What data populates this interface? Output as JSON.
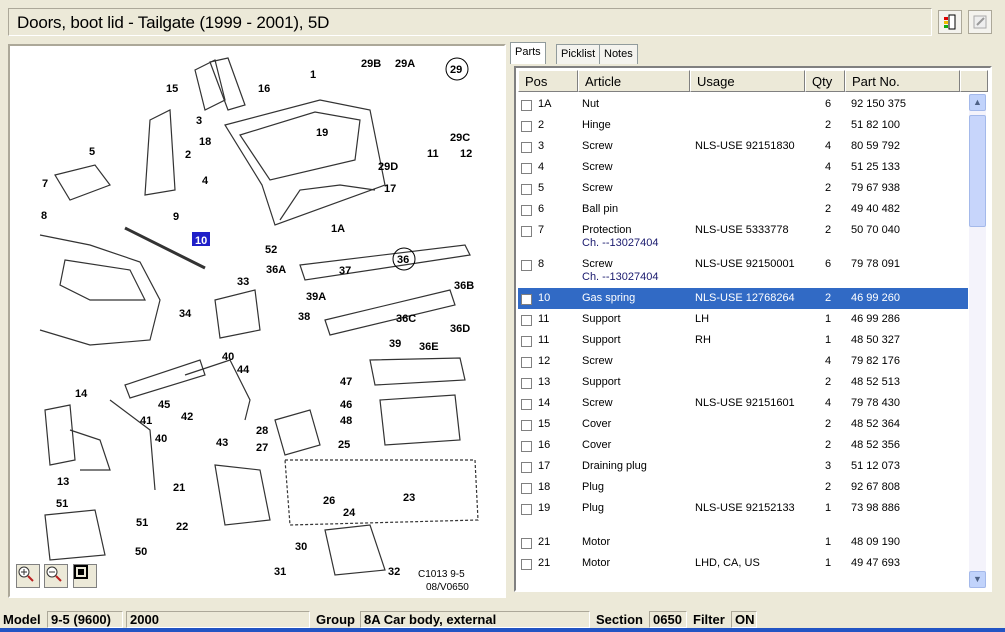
{
  "title": "Doors, boot lid - Tailgate   (1999 - 2001), 5D",
  "toolbar": {
    "icons": [
      "exit-icon",
      "note-icon"
    ]
  },
  "tabs": [
    {
      "label": "Parts",
      "active": true
    },
    {
      "label": "Picklist"
    },
    {
      "label": "Notes"
    }
  ],
  "columns": [
    "Pos",
    "Article",
    "Usage",
    "Qty",
    "Part No."
  ],
  "rows": [
    {
      "pos": "1A",
      "article": "Nut",
      "usage": "",
      "qty": "6",
      "part": "92 150 375"
    },
    {
      "pos": "2",
      "article": "Hinge",
      "usage": "",
      "qty": "2",
      "part": "51 82 100"
    },
    {
      "pos": "3",
      "article": "Screw",
      "usage": "NLS-USE 92151830",
      "qty": "4",
      "part": "80 59 792"
    },
    {
      "pos": "4",
      "article": "Screw",
      "usage": "",
      "qty": "4",
      "part": "51 25 133"
    },
    {
      "pos": "5",
      "article": "Screw",
      "usage": "",
      "qty": "2",
      "part": "79 67 938"
    },
    {
      "pos": "6",
      "article": "Ball pin",
      "usage": "",
      "qty": "2",
      "part": "49 40 482"
    },
    {
      "pos": "7",
      "article": "Protection",
      "usage": "NLS-USE 5333778",
      "qty": "2",
      "part": "50 70 040",
      "note": "Ch. --13027404"
    },
    {
      "pos": "8",
      "article": "Screw",
      "usage": "NLS-USE 92150001",
      "qty": "6",
      "part": "79 78 091",
      "note": "Ch. --13027404"
    },
    {
      "pos": "10",
      "article": "Gas spring",
      "usage": "NLS-USE 12768264",
      "qty": "2",
      "part": "46 99 260",
      "selected": true
    },
    {
      "pos": "11",
      "article": "Support",
      "usage": "LH",
      "qty": "1",
      "part": "46 99 286"
    },
    {
      "pos": "11",
      "article": "Support",
      "usage": "RH",
      "qty": "1",
      "part": "48 50 327"
    },
    {
      "pos": "12",
      "article": "Screw",
      "usage": "",
      "qty": "4",
      "part": "79 82 176"
    },
    {
      "pos": "13",
      "article": "Support",
      "usage": "",
      "qty": "2",
      "part": "48 52 513"
    },
    {
      "pos": "14",
      "article": "Screw",
      "usage": "NLS-USE 92151601",
      "qty": "4",
      "part": "79 78 430"
    },
    {
      "pos": "15",
      "article": "Cover",
      "usage": "",
      "qty": "2",
      "part": "48 52 364"
    },
    {
      "pos": "16",
      "article": "Cover",
      "usage": "",
      "qty": "2",
      "part": "48 52 356"
    },
    {
      "pos": "17",
      "article": "Draining plug",
      "usage": "",
      "qty": "3",
      "part": "51 12 073"
    },
    {
      "pos": "18",
      "article": "Plug",
      "usage": "",
      "qty": "2",
      "part": "92 67 808"
    },
    {
      "pos": "19",
      "article": "Plug",
      "usage": "NLS-USE 92152133",
      "qty": "1",
      "part": "73 98 886",
      "note": ""
    },
    {
      "pos": "21",
      "article": "Motor",
      "usage": "",
      "qty": "1",
      "part": "48 09 190"
    },
    {
      "pos": "21",
      "article": "Motor",
      "usage": "LHD, CA, US",
      "qty": "1",
      "part": "49 47 693"
    }
  ],
  "colors": {
    "selection": "#316ac5",
    "highlight_callout": "#1f1fc8"
  },
  "diagram": {
    "callouts": [
      "15",
      "16",
      "1",
      "29B",
      "29A",
      "29",
      "3",
      "19",
      "2",
      "18",
      "29C",
      "5",
      "11",
      "12",
      "4",
      "29D",
      "17",
      "7",
      "8",
      "9",
      "1A",
      "10",
      "52",
      "36",
      "36A",
      "37",
      "33",
      "36B",
      "39A",
      "34",
      "38",
      "36C",
      "36D",
      "39",
      "36E",
      "40",
      "44",
      "47",
      "14",
      "45",
      "46",
      "42",
      "48",
      "41",
      "43",
      "40",
      "28",
      "27",
      "25",
      "13",
      "21",
      "26",
      "23",
      "24",
      "51",
      "51",
      "22",
      "50",
      "30",
      "31",
      "32"
    ],
    "highlighted": "10",
    "code1": "C1013  9-5",
    "code2": "08/V0650",
    "zoom_buttons": [
      "zoom-in-icon",
      "zoom-out-icon",
      "fit-icon"
    ]
  },
  "status": {
    "model_label": "Model",
    "model": "9-5 (9600)",
    "year": "2000",
    "group_label": "Group",
    "group": "8A Car body, external",
    "section_label": "Section",
    "section": "0650",
    "filter_label": "Filter",
    "filter": "ON"
  }
}
